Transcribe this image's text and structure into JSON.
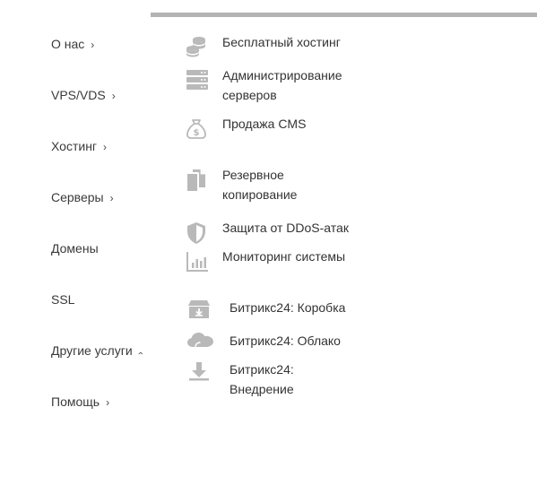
{
  "nav": {
    "items": [
      {
        "label": "О нас",
        "chevron": "›"
      },
      {
        "label": "VPS/VDS",
        "chevron": "›"
      },
      {
        "label": "Хостинг",
        "chevron": "›"
      },
      {
        "label": "Серверы",
        "chevron": "›"
      },
      {
        "label": "Домены",
        "chevron": ""
      },
      {
        "label": "SSL",
        "chevron": ""
      },
      {
        "label": "Другие услуги",
        "chevron": "›"
      },
      {
        "label": "Помощь",
        "chevron": "›"
      }
    ]
  },
  "submenu": {
    "items": [
      {
        "label_line1": "Бесплатный хостинг",
        "label_line2": "",
        "icon": "coins-stack-icon"
      },
      {
        "label_line1": "Администрирование",
        "label_line2": "серверов",
        "icon": "server-rack-icon"
      },
      {
        "label_line1": "Продажа CMS",
        "label_line2": "",
        "icon": "money-bag-icon"
      },
      {
        "label_line1": "Резервное",
        "label_line2": "копирование",
        "icon": "copy-documents-icon"
      },
      {
        "label_line1": "Защита от DDoS-атак",
        "label_line2": "",
        "icon": "shield-icon"
      },
      {
        "label_line1": "Мониторинг системы",
        "label_line2": "",
        "icon": "bar-chart-icon"
      },
      {
        "label_line1": "Битрикс24: Коробка",
        "label_line2": "",
        "icon": "box-download-icon"
      },
      {
        "label_line1": "Битрикс24: Облако",
        "label_line2": "",
        "icon": "cloud-icon"
      },
      {
        "label_line1": "Битрикс24:",
        "label_line2": "Внедрение",
        "icon": "download-tray-icon"
      }
    ]
  },
  "colors": {
    "icon": "#b9b9b9",
    "text": "#333333",
    "rule": "#b3b3b3"
  }
}
